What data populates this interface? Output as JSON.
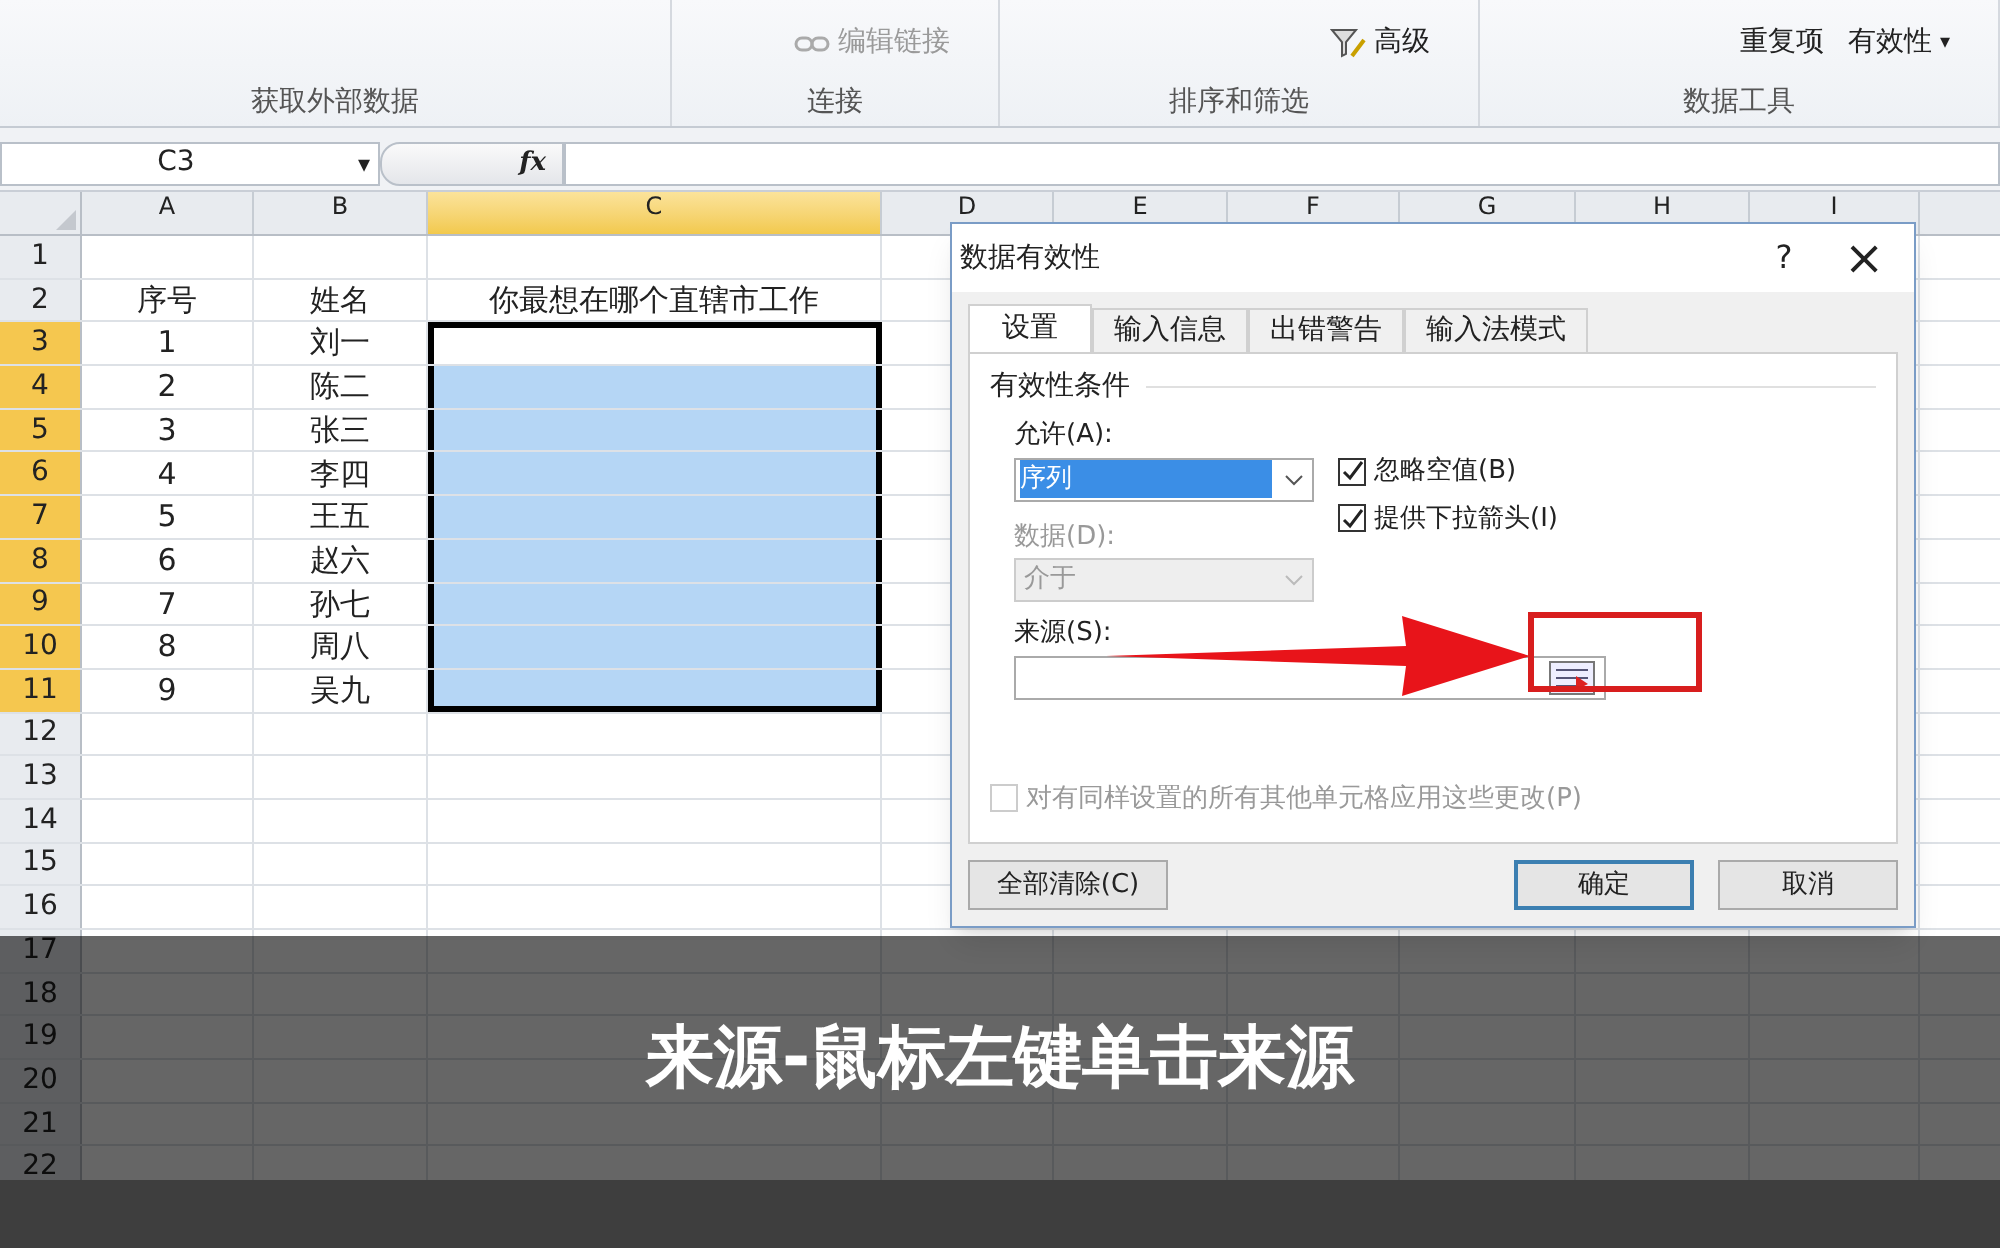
{
  "ribbon": {
    "groups": [
      {
        "label": "获取外部数据"
      },
      {
        "label": "连接",
        "items": [
          {
            "kind": "link",
            "label": "编辑链接",
            "disabled": true
          }
        ]
      },
      {
        "label": "排序和筛选",
        "items": [
          {
            "kind": "filter",
            "label": "高级",
            "disabled": false
          }
        ]
      },
      {
        "label": "数据工具",
        "items": [
          {
            "kind": "plain",
            "label": "重复项",
            "disabled": false
          },
          {
            "kind": "dropdown",
            "label": "有效性",
            "caret": "▾",
            "disabled": false
          }
        ]
      }
    ]
  },
  "formula_bar": {
    "name_box": "C3",
    "fx": "fx",
    "value_caret": "▾"
  },
  "columns": [
    {
      "label": "A",
      "selected": false
    },
    {
      "label": "B",
      "selected": false
    },
    {
      "label": "C",
      "selected": true
    },
    {
      "label": "D",
      "selected": false
    },
    {
      "label": "E",
      "selected": false
    },
    {
      "label": "F",
      "selected": false
    },
    {
      "label": "G",
      "selected": false
    },
    {
      "label": "H",
      "selected": false
    },
    {
      "label": "I",
      "selected": false
    }
  ],
  "rows": [
    {
      "number": "1",
      "selected": false
    },
    {
      "number": "2",
      "selected": false,
      "a": "序号",
      "b": "姓名",
      "c": "你最想在哪个直辖市工作"
    },
    {
      "number": "3",
      "selected": true,
      "a": "1",
      "b": "刘一"
    },
    {
      "number": "4",
      "selected": true,
      "a": "2",
      "b": "陈二"
    },
    {
      "number": "5",
      "selected": true,
      "a": "3",
      "b": "张三"
    },
    {
      "number": "6",
      "selected": true,
      "a": "4",
      "b": "李四"
    },
    {
      "number": "7",
      "selected": true,
      "a": "5",
      "b": "王五"
    },
    {
      "number": "8",
      "selected": true,
      "a": "6",
      "b": "赵六"
    },
    {
      "number": "9",
      "selected": true,
      "a": "7",
      "b": "孙七"
    },
    {
      "number": "10",
      "selected": true,
      "a": "8",
      "b": "周八"
    },
    {
      "number": "11",
      "selected": true,
      "a": "9",
      "b": "吴九"
    },
    {
      "number": "12",
      "selected": false
    },
    {
      "number": "13",
      "selected": false
    },
    {
      "number": "14",
      "selected": false
    },
    {
      "number": "15",
      "selected": false
    },
    {
      "number": "16",
      "selected": false
    },
    {
      "number": "17",
      "selected": false
    },
    {
      "number": "18",
      "selected": false
    },
    {
      "number": "19",
      "selected": false
    },
    {
      "number": "20",
      "selected": false
    },
    {
      "number": "21",
      "selected": false
    },
    {
      "number": "22",
      "selected": false
    }
  ],
  "dialog": {
    "title": "数据有效性",
    "help": "?",
    "close": "×",
    "tabs": [
      {
        "label": "设置",
        "selected": true
      },
      {
        "label": "输入信息",
        "selected": false
      },
      {
        "label": "出错警告",
        "selected": false
      },
      {
        "label": "输入法模式",
        "selected": false
      }
    ],
    "section": "有效性条件",
    "allow": {
      "label": "允许(A):",
      "value": "序列",
      "disabled": false
    },
    "data": {
      "label": "数据(D):",
      "value": "介于",
      "disabled": true
    },
    "checkboxes": [
      {
        "label": "忽略空值(B)",
        "checked": true,
        "disabled": false
      },
      {
        "label": "提供下拉箭头(I)",
        "checked": true,
        "disabled": false
      }
    ],
    "source": {
      "label": "来源(S):"
    },
    "apply_all": {
      "label": "对有同样设置的所有其他单元格应用这些更改(P)",
      "checked": false,
      "disabled": true
    },
    "buttons": [
      {
        "label": "全部清除(C)",
        "default": false
      },
      {
        "label": "确定",
        "default": true
      },
      {
        "label": "取消",
        "default": false
      }
    ]
  },
  "caption": "来源-鼠标左键单击来源"
}
